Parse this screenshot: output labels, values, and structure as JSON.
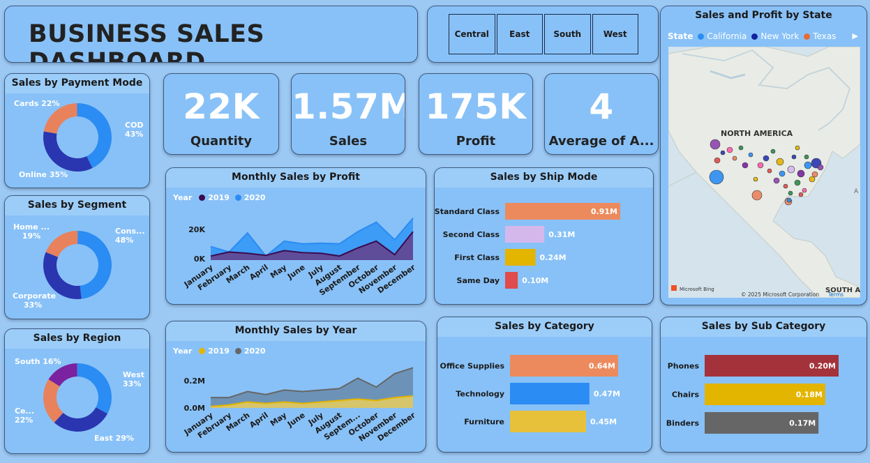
{
  "header": {
    "title": "BUSINESS SALES DASHBOARD"
  },
  "slicer": {
    "options": [
      "Central",
      "East",
      "South",
      "West"
    ]
  },
  "kpis": [
    {
      "value": "22K",
      "label": "Quantity"
    },
    {
      "value": "1.57M",
      "label": "Sales"
    },
    {
      "value": "175K",
      "label": "Profit"
    },
    {
      "value": "4",
      "label": "Average of A..."
    }
  ],
  "payment": {
    "title": "Sales by Payment Mode",
    "labels": [
      "Cards 22%",
      "COD\n43%",
      "Online 35%"
    ]
  },
  "segment": {
    "title": "Sales by Segment",
    "labels": [
      "Home ...\n19%",
      "Cons...\n48%",
      "Corporate\n33%"
    ]
  },
  "region": {
    "title": "Sales by Region",
    "labels": [
      "South 16%",
      "West\n33%",
      "Ce...\n22%",
      "East 29%"
    ]
  },
  "monthly_profit": {
    "title": "Monthly Sales by Profit",
    "legend_title": "Year",
    "series_labels": [
      "2019",
      "2020"
    ],
    "y_ticks": [
      "20K",
      "0K"
    ]
  },
  "monthly_year": {
    "title": "Monthly Sales by Year",
    "legend_title": "Year",
    "series_labels": [
      "2019",
      "2020"
    ],
    "y_ticks": [
      "0.2M",
      "0.0M"
    ]
  },
  "ship": {
    "title": "Sales by Ship Mode"
  },
  "category": {
    "title": "Sales by Category"
  },
  "subcategory": {
    "title": "Sales by Sub Category"
  },
  "map": {
    "title": "Sales and Profit by State",
    "legend_title": "State",
    "legend_items": [
      "California",
      "New York",
      "Texas"
    ],
    "region_label": "NORTH AMERICA",
    "south_label": "SOUTH AM",
    "bing": "Microsoft Bing",
    "copyright": "© 2025 Microsoft Corporation",
    "terms": "Terms",
    "edge_label": "A"
  },
  "colors": {
    "card": "#88c1f7",
    "accent_blue": "#2b8cf3",
    "dark_navy": "#2a2f9e",
    "orange": "#e8825d",
    "purple": "#7a22a0"
  },
  "chart_data": [
    {
      "type": "pie",
      "title": "Sales by Payment Mode",
      "categories": [
        "Cards",
        "COD",
        "Online"
      ],
      "values": [
        22,
        43,
        35
      ]
    },
    {
      "type": "pie",
      "title": "Sales by Segment",
      "categories": [
        "Home ...",
        "Cons...",
        "Corporate"
      ],
      "values": [
        19,
        48,
        33
      ]
    },
    {
      "type": "pie",
      "title": "Sales by Region",
      "categories": [
        "South",
        "West",
        "Ce...",
        "East"
      ],
      "values": [
        16,
        33,
        22,
        29
      ]
    },
    {
      "type": "area",
      "title": "Monthly Sales by Profit",
      "x": [
        "January",
        "February",
        "March",
        "April",
        "May",
        "June",
        "July",
        "August",
        "September",
        "October",
        "November",
        "December"
      ],
      "series": [
        {
          "name": "2019",
          "values": [
            3000,
            6000,
            5000,
            3500,
            7000,
            5500,
            5000,
            3000,
            9000,
            14000,
            4000,
            21000
          ]
        },
        {
          "name": "2020",
          "values": [
            10000,
            6000,
            20000,
            3000,
            14000,
            12000,
            12500,
            12000,
            21000,
            28000,
            15000,
            31000
          ]
        }
      ],
      "ylim": [
        0,
        35000
      ]
    },
    {
      "type": "area",
      "title": "Monthly Sales by Year",
      "x": [
        "January",
        "February",
        "March",
        "April",
        "May",
        "June",
        "July",
        "August",
        "Septem...",
        "October",
        "November",
        "December"
      ],
      "series": [
        {
          "name": "2019",
          "values": [
            0.01,
            0.02,
            0.04,
            0.03,
            0.04,
            0.03,
            0.04,
            0.05,
            0.06,
            0.05,
            0.07,
            0.08
          ]
        },
        {
          "name": "2020",
          "values": [
            0.07,
            0.07,
            0.11,
            0.09,
            0.12,
            0.11,
            0.12,
            0.13,
            0.2,
            0.14,
            0.23,
            0.27
          ]
        }
      ],
      "ylim": [
        0,
        0.3
      ]
    },
    {
      "type": "bar",
      "title": "Sales by Ship Mode",
      "categories": [
        "Standard Class",
        "Second Class",
        "First Class",
        "Same Day"
      ],
      "values": [
        0.91,
        0.31,
        0.24,
        0.1
      ],
      "labels": [
        "0.91M",
        "0.31M",
        "0.24M",
        "0.10M"
      ]
    },
    {
      "type": "bar",
      "title": "Sales by Category",
      "categories": [
        "Office Supplies",
        "Technology",
        "Furniture"
      ],
      "values": [
        0.64,
        0.47,
        0.45
      ],
      "labels": [
        "0.64M",
        "0.47M",
        "0.45M"
      ]
    },
    {
      "type": "bar",
      "title": "Sales by Sub Category",
      "categories": [
        "Phones",
        "Chairs",
        "Binders"
      ],
      "values": [
        0.2,
        0.18,
        0.17
      ],
      "labels": [
        "0.20M",
        "0.18M",
        "0.17M"
      ]
    }
  ]
}
